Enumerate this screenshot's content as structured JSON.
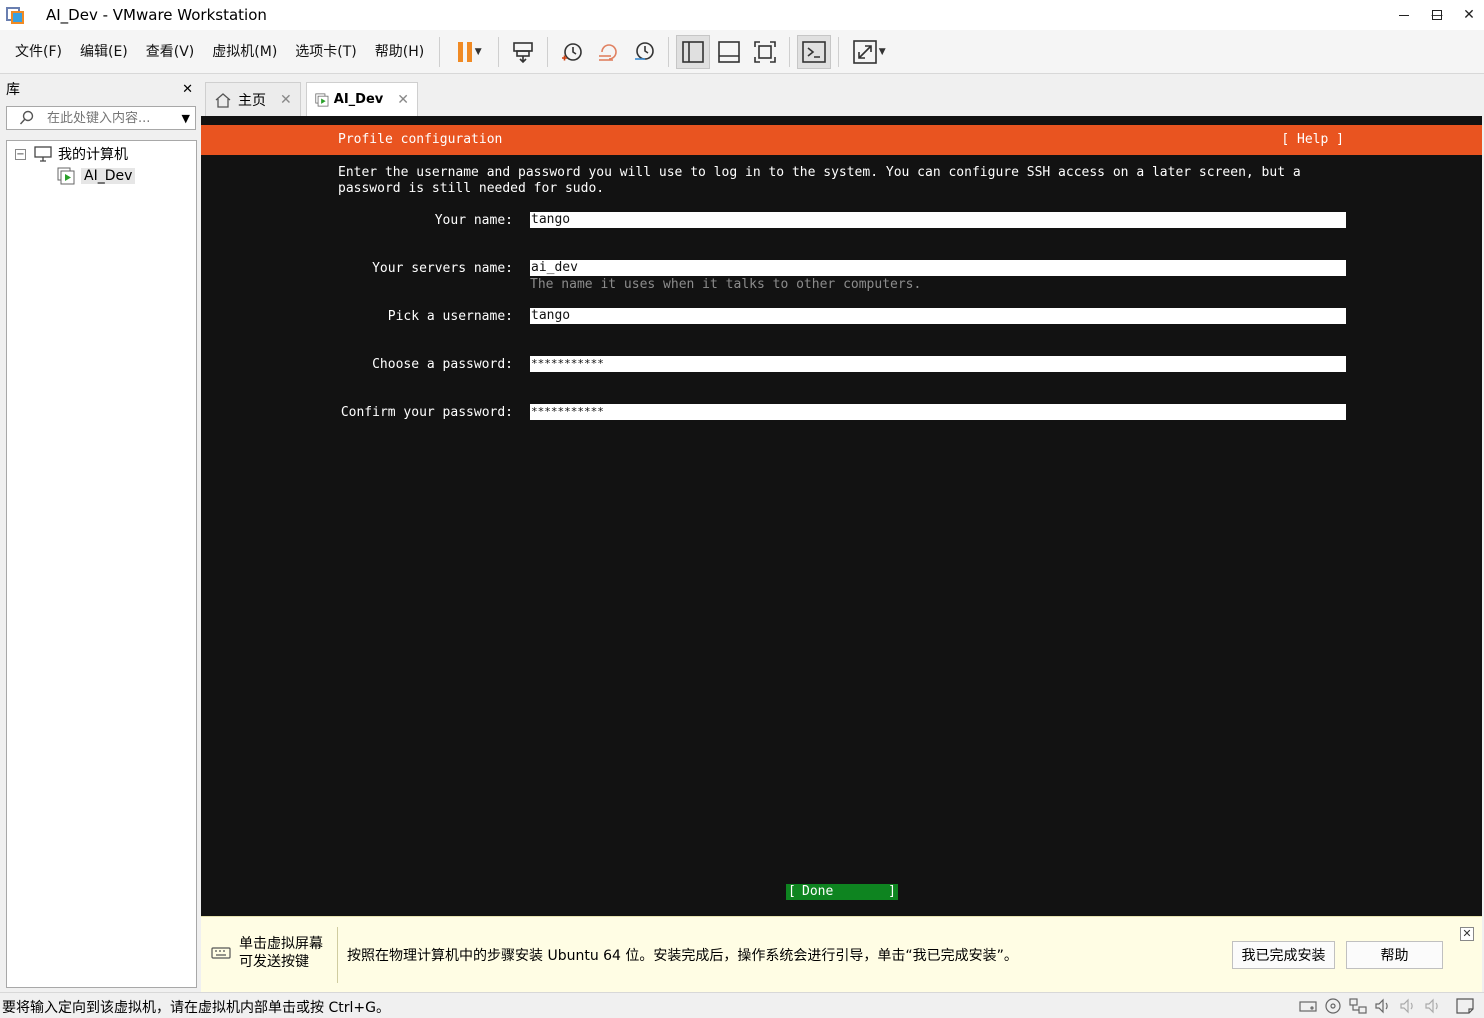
{
  "window": {
    "title": "AI_Dev - VMware Workstation",
    "minimize": "—",
    "maximize": "☐",
    "close": "✕"
  },
  "menu": [
    "文件(F)",
    "编辑(E)",
    "查看(V)",
    "虚拟机(M)",
    "选项卡(T)",
    "帮助(H)"
  ],
  "toolbar": {
    "icons": [
      "pause-icon",
      "send-ctrl-alt-del-icon",
      "snapshot-take-icon",
      "snapshot-revert-icon",
      "snapshot-manager-icon",
      "show-library-icon",
      "show-thumbnail-bar-icon",
      "full-screen-icon",
      "console-view-icon",
      "stretch-guest-icon"
    ],
    "accent": "#f08a24"
  },
  "library": {
    "title": "库",
    "close": "✕",
    "search_placeholder": "在此处键入内容...",
    "tree": [
      {
        "label": "我的计算机",
        "expander": "−"
      },
      {
        "label": "AI_Dev"
      }
    ]
  },
  "tabs": [
    {
      "label": "主页",
      "close": "✕"
    },
    {
      "label": "AI_Dev",
      "close": "✕"
    }
  ],
  "installer": {
    "header": "Profile configuration",
    "help": "[ Help ]",
    "header_color": "#e95420",
    "intro": "Enter the username and password you will use to log in to the system. You can configure SSH access on a later screen, but a\npassword is still needed for sudo.",
    "fields": [
      {
        "label": "Your name:",
        "value": "tango"
      },
      {
        "label": "Your servers name:",
        "value": "ai_dev",
        "hint": "The name it uses when it talks to other computers."
      },
      {
        "label": "Pick a username:",
        "value": "tango"
      },
      {
        "label": "Choose a password:",
        "value": "***********"
      },
      {
        "label": "Confirm your password:",
        "value": "***********"
      }
    ],
    "done": {
      "left": "[",
      "label": "Done",
      "right": "]",
      "color": "#0e8420"
    }
  },
  "hintbar": {
    "left_line1": "单击虚拟屏幕",
    "left_line2": "可发送按键",
    "message": "按照在物理计算机中的步骤安装 Ubuntu 64 位。安装完成后，操作系统会进行引导，单击“我已完成安装”。",
    "btn_done": "我已完成安装",
    "btn_help": "帮助",
    "close": "✕"
  },
  "status": {
    "text": "要将输入定向到该虚拟机，请在虚拟机内部单击或按 Ctrl+G。",
    "icons": [
      "hard-disk-icon",
      "cd-dvd-icon",
      "network-icon",
      "sound-icon",
      "sound-icon-2",
      "sound-icon-3",
      "message-log-icon"
    ]
  }
}
